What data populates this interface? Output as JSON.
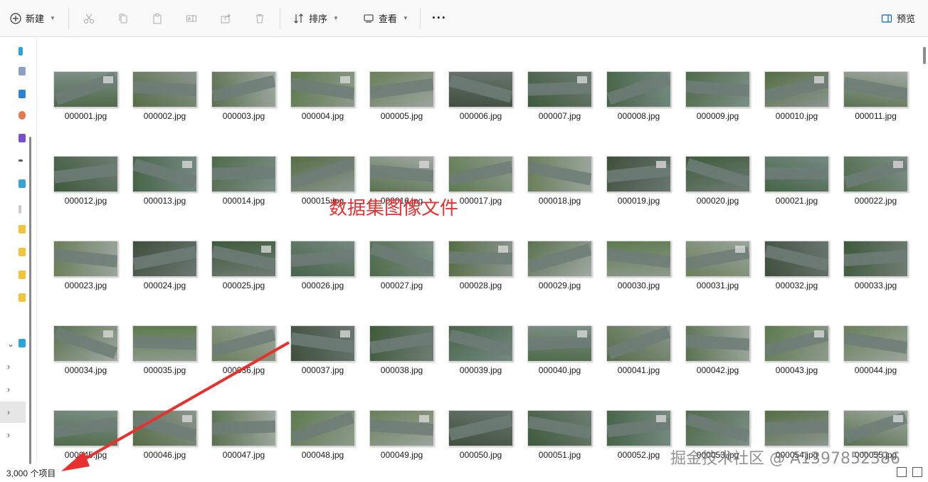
{
  "toolbar": {
    "new_label": "新建",
    "sort_label": "排序",
    "view_label": "查看",
    "more_label": "···",
    "preview_label": "预览"
  },
  "files": [
    "000001.jpg",
    "000002.jpg",
    "000003.jpg",
    "000004.jpg",
    "000005.jpg",
    "000006.jpg",
    "000007.jpg",
    "000008.jpg",
    "000009.jpg",
    "000010.jpg",
    "000011.jpg",
    "000012.jpg",
    "000013.jpg",
    "000014.jpg",
    "000015.jpg",
    "000016.jpg",
    "000017.jpg",
    "000018.jpg",
    "000019.jpg",
    "000020.jpg",
    "000021.jpg",
    "000022.jpg",
    "000023.jpg",
    "000024.jpg",
    "000025.jpg",
    "000026.jpg",
    "000027.jpg",
    "000028.jpg",
    "000029.jpg",
    "000030.jpg",
    "000031.jpg",
    "000032.jpg",
    "000033.jpg",
    "000034.jpg",
    "000035.jpg",
    "000036.jpg",
    "000037.jpg",
    "000038.jpg",
    "000039.jpg",
    "000040.jpg",
    "000041.jpg",
    "000042.jpg",
    "000043.jpg",
    "000044.jpg",
    "000045.jpg",
    "000046.jpg",
    "000047.jpg",
    "000048.jpg",
    "000049.jpg",
    "000050.jpg",
    "000051.jpg",
    "000052.jpg",
    "000053.jpg",
    "000054.jpg",
    "000055.jpg"
  ],
  "status": {
    "item_count": "3,000 个项目"
  },
  "annotation": {
    "label": "数据集图像文件"
  },
  "watermark": "掘金技术社区 @ A1397852386",
  "colors": {
    "annotation_red": "#e8312f",
    "accent": "#0067c0"
  }
}
